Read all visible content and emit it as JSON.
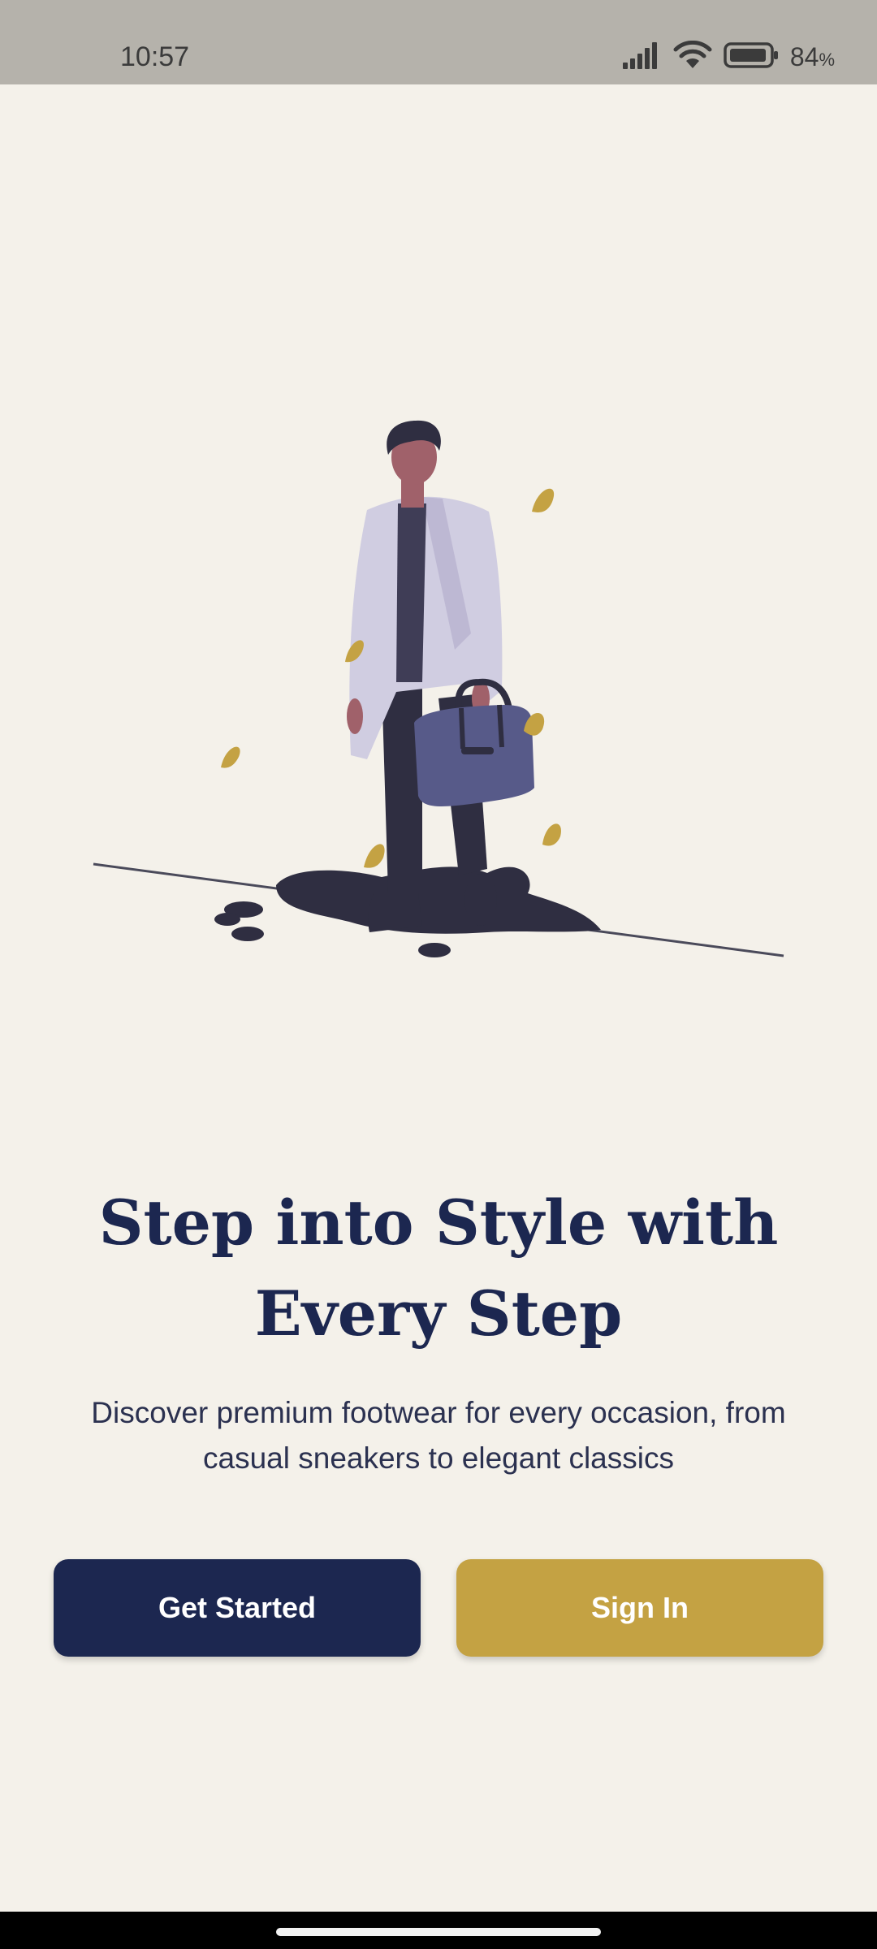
{
  "status_bar": {
    "time": "10:57",
    "battery_value": "84",
    "battery_unit": "%",
    "icons": [
      "signal-icon",
      "wifi-icon",
      "battery-icon"
    ]
  },
  "illustration": {
    "name": "man-with-bag-illustration"
  },
  "hero": {
    "title": "Step into Style with Every Step",
    "subtitle": "Discover premium footwear for every occasion, from casual sneakers to elegant classics"
  },
  "actions": {
    "get_started_label": "Get Started",
    "sign_in_label": "Sign In"
  },
  "colors": {
    "background": "#f4f1ea",
    "primary": "#1c2750",
    "accent": "#c4a243",
    "status_bar": "#b5b2ab"
  }
}
